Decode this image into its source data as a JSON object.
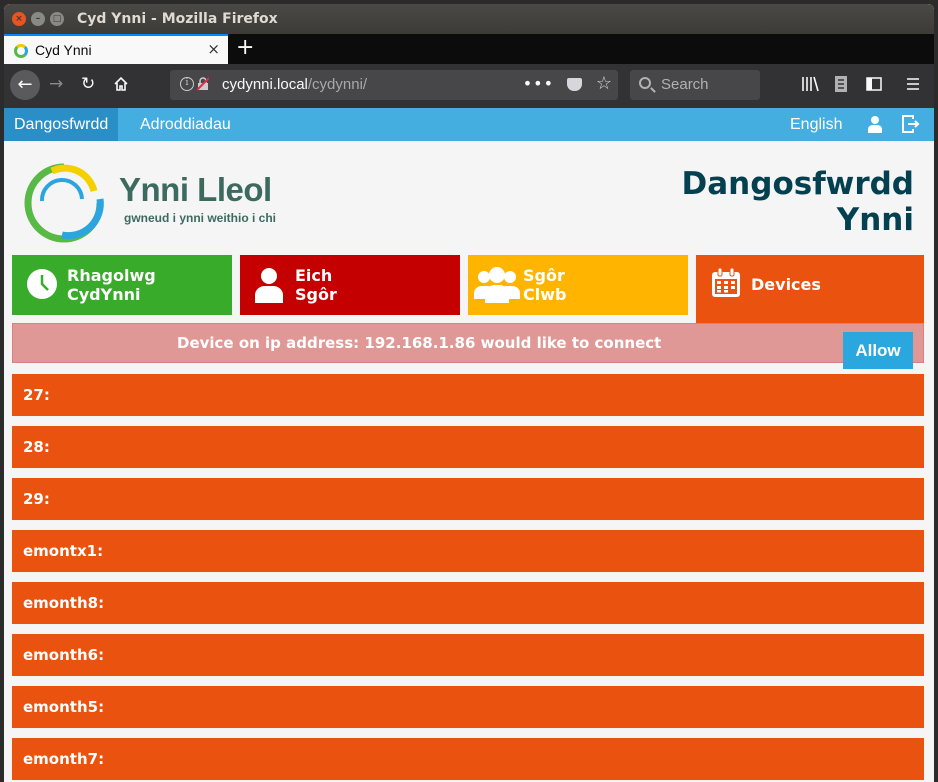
{
  "window": {
    "title": "Cyd Ynni - Mozilla Firefox"
  },
  "browser": {
    "tab_title": "Cyd Ynni",
    "tab_close": "×",
    "new_tab": "+",
    "url_host": "cydynni.local",
    "url_path": "/cydynni/",
    "url_more": "•••",
    "search_placeholder": "Search"
  },
  "appnav": {
    "dashboard": "Dangosfwrdd",
    "reports": "Adroddiadau",
    "language": "English"
  },
  "header": {
    "logo_title": "Ynni Lleol",
    "logo_tagline": "gwneud i ynni weithio i chi",
    "page_title_line1": "Dangosfwrdd",
    "page_title_line2": "Ynni"
  },
  "tiles": [
    {
      "line1": "Rhagolwg",
      "line2": "CydYnni",
      "color": "#39ab2a"
    },
    {
      "line1": "Eich",
      "line2": "Sgôr",
      "color": "#c40000"
    },
    {
      "line1": "Sgôr",
      "line2": "Clwb",
      "color": "#ffb400"
    },
    {
      "line1": "Devices",
      "color": "#ea5210"
    }
  ],
  "notice": {
    "message": "Device on ip address: 192.168.1.86 would like to connect",
    "allow_label": "Allow"
  },
  "devices": [
    "27:",
    "28:",
    "29:",
    "emontx1:",
    "emonth8:",
    "emonth6:",
    "emonth5:",
    "emonth7:"
  ]
}
